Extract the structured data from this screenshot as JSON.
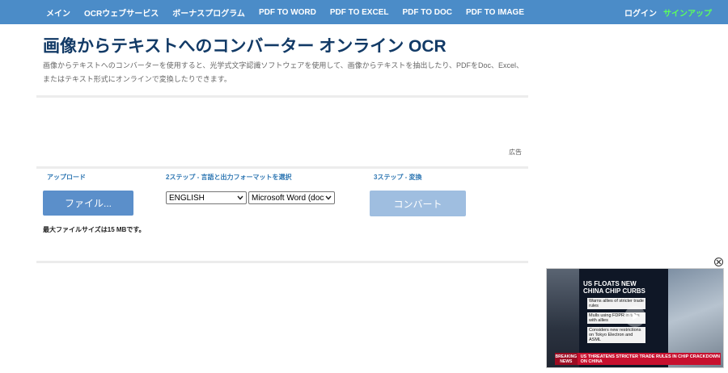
{
  "nav": {
    "items": [
      "メイン",
      "OCRウェブサービス",
      "ボーナスプログラム",
      "PDF TO WORD",
      "PDF TO EXCEL",
      "PDF TO DOC",
      "PDF TO IMAGE"
    ],
    "login": "ログイン",
    "signup": "サインアップ"
  },
  "page": {
    "title": "画像からテキストへのコンバーター オンライン OCR",
    "description": "画像からテキストへのコンバーターを使用すると、光学式文字認識ソフトウェアを使用して、画像からテキストを抽出したり、PDFをDoc、Excel、またはテキスト形式にオンラインで変換したりできます。"
  },
  "ad": {
    "label": "広告"
  },
  "steps": {
    "upload_label": "アップロード",
    "step2_label": "2ステップ - 言語と出力フォーマットを選択",
    "step3_label": "3ステップ - 変換",
    "file_button": "ファイル...",
    "language_select": "ENGLISH",
    "format_select": "Microsoft Word (docx)",
    "convert_button": "コンバート",
    "max_size": "最大ファイルサイズは15 MBです。"
  },
  "video": {
    "headline": "US FLOATS NEW CHINA CHIP CURBS",
    "stories": [
      "Warns allies of stricter trade rules",
      "Mulls using FDPR in talks with allies",
      "Considers new restrictions on Tokyo Electron and ASML"
    ],
    "ticker_tag_1": "BREAKING",
    "ticker_tag_2": "NEWS",
    "ticker_text": "US THREATENS STRICTER TRADE RULES IN CHIP CRACKDOWN ON CHINA"
  },
  "colors": {
    "nav_bg": "#4b8cc8",
    "title": "#123a66",
    "accent": "#2f77b3",
    "signup": "#5cff5c",
    "file_button": "#5b8fca",
    "convert_button": "#9fbee0"
  }
}
